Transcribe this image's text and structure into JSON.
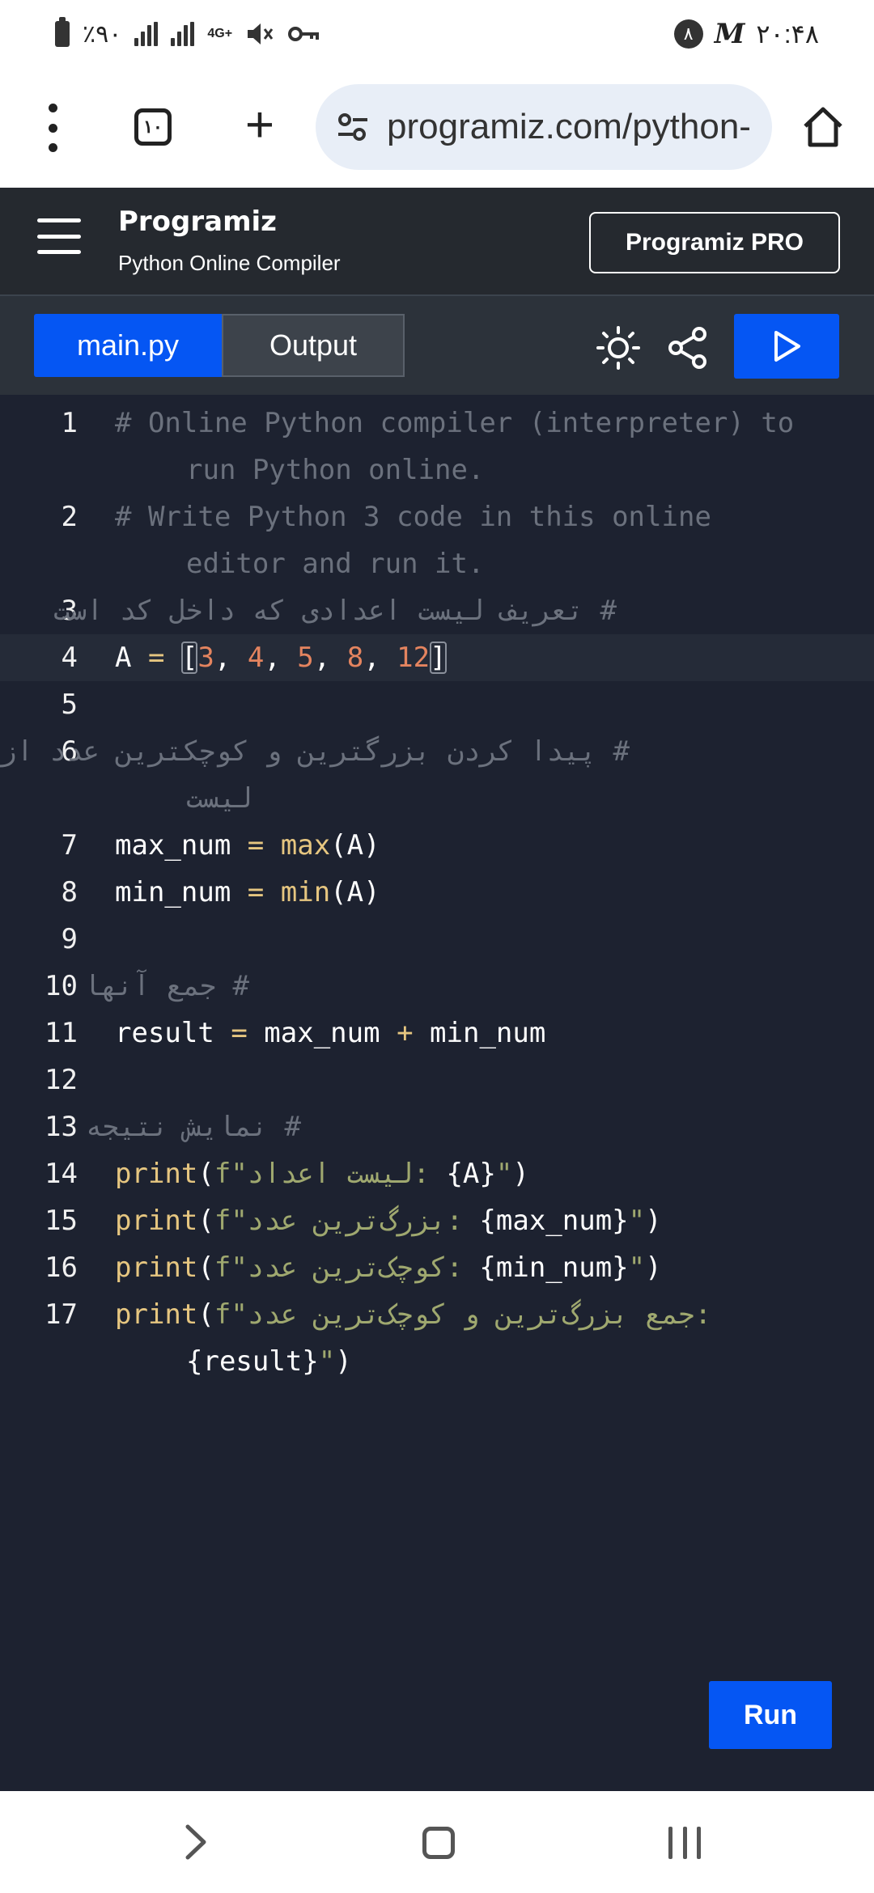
{
  "status_bar": {
    "battery_text": "٪۹۰",
    "network_type": "4G+",
    "notification_badge": "۸",
    "m_badge": "M",
    "time": "۲۰:۴۸"
  },
  "browser": {
    "tab_count": "۱۰",
    "url": "programiz.com/python-",
    "new_tab_symbol": "+"
  },
  "header": {
    "logo": "Programiz",
    "subtitle": "Python Online Compiler",
    "pro_button": "Programiz PRO"
  },
  "toolbar": {
    "tab_main": "main.py",
    "tab_output": "Output"
  },
  "editor": {
    "lines": [
      {
        "num": "1",
        "c1": "# Online Python compiler (interpreter) to",
        "c2": "run Python online."
      },
      {
        "num": "2",
        "c1": "# Write Python 3 code in this online",
        "c2": "editor and run it."
      },
      {
        "num": "3",
        "c1": "# تعریف لیست اعدادی که داخل کد است"
      },
      {
        "num": "4",
        "var": "A",
        "eq": "=",
        "open": "[",
        "n1": "3",
        "n2": "4",
        "n3": "5",
        "n4": "8",
        "n5": "12",
        "close": "]"
      },
      {
        "num": "5"
      },
      {
        "num": "6",
        "c1": "# پیدا کردن بزرگترین و کوچکترین عدد از",
        "c2": "لیست"
      },
      {
        "num": "7",
        "var": "max_num",
        "eq": "=",
        "fn": "max",
        "arg": "(A)"
      },
      {
        "num": "8",
        "var": "min_num",
        "eq": "=",
        "fn": "min",
        "arg": "(A)"
      },
      {
        "num": "9"
      },
      {
        "num": "10",
        "c1": "# جمع آنها"
      },
      {
        "num": "11",
        "var": "result",
        "eq": "=",
        "a": "max_num",
        "op": "+",
        "b": "min_num"
      },
      {
        "num": "12"
      },
      {
        "num": "13",
        "c1": "# نمایش نتیجه"
      },
      {
        "num": "14",
        "fn": "print",
        "open": "(",
        "str": "f\"لیست اعداد: ",
        "expr": "{A}",
        "end": "\"",
        "close": ")"
      },
      {
        "num": "15",
        "fn": "print",
        "open": "(",
        "str": "f\"بزرگ‌ترین عدد: ",
        "expr": "{max_num}",
        "end": "\"",
        "close": ")"
      },
      {
        "num": "16",
        "fn": "print",
        "open": "(",
        "str": "f\"کوچک‌ترین عدد: ",
        "expr": "{min_num}",
        "end": "\"",
        "close": ")"
      },
      {
        "num": "17",
        "fn": "print",
        "open": "(",
        "str": "f\"جمع بزرگ‌ترین و کوچک‌ترین عدد:",
        "expr": "{result}",
        "end": "\"",
        "close": ")"
      }
    ]
  },
  "run_button": "Run",
  "colors": {
    "accent": "#0556f3",
    "editor_bg": "#1d2230",
    "header_bg": "#25292f",
    "comment": "#6b717d",
    "string": "#9fa86f",
    "function": "#e6c680",
    "number": "#e4845f"
  },
  "icons": {
    "menu": "more-vert-icon",
    "tabs": "tab-switcher-icon",
    "new_tab": "plus-icon",
    "site_settings": "tune-icon",
    "home": "home-icon",
    "hamburger": "hamburger-icon",
    "theme": "sun-icon",
    "share": "share-icon",
    "run": "play-icon"
  }
}
